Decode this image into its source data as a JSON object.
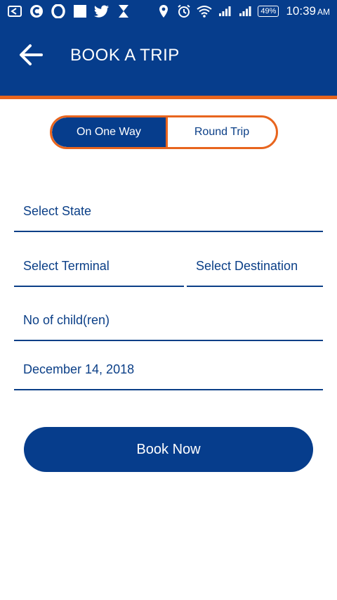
{
  "status_bar": {
    "icons_left": [
      "cast-icon",
      "browser-c-icon",
      "opera-icon",
      "white-square-icon",
      "twitter-icon",
      "hourglass-icon"
    ],
    "icons_right": [
      "location-pin-icon",
      "alarm-icon",
      "wifi-icon",
      "signal-icon",
      "signal-icon"
    ],
    "battery": "49%",
    "time": "10:39",
    "ampm": "AM"
  },
  "header": {
    "title": "BOOK A TRIP",
    "back_icon": "arrow-left-icon"
  },
  "trip_type": {
    "options": [
      "On One Way",
      "Round Trip"
    ],
    "selected": "On One Way"
  },
  "form": {
    "state": "Select State",
    "terminal": "Select Terminal",
    "destination": "Select Destination",
    "children": "No of child(ren)",
    "date": "December 14, 2018"
  },
  "actions": {
    "book": "Book Now"
  },
  "colors": {
    "primary": "#063d8c",
    "accent": "#e8651e",
    "text": "#0b3f87"
  }
}
